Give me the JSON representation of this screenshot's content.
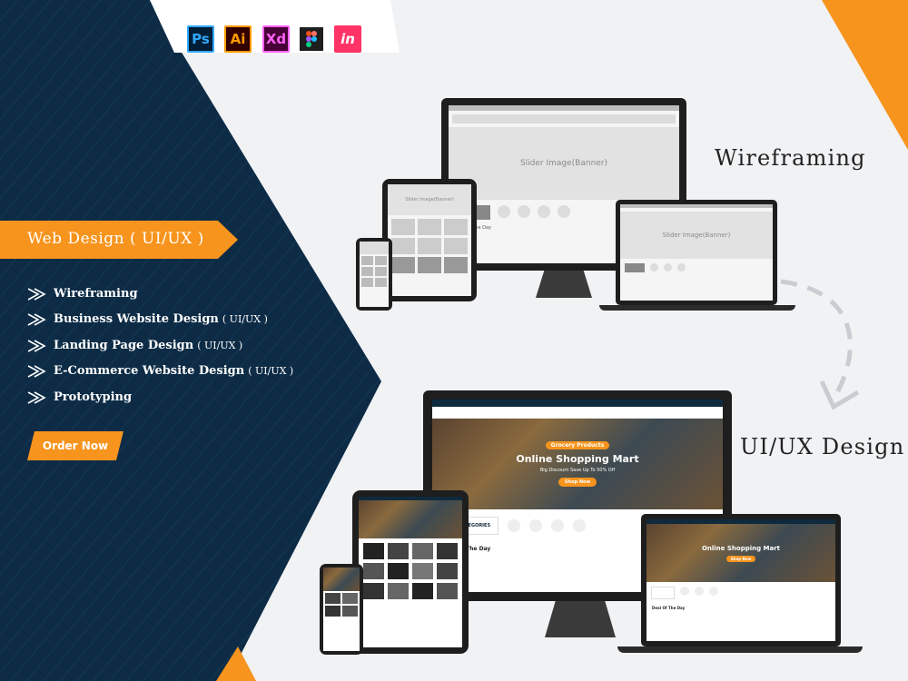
{
  "tools": [
    {
      "name": "Ps",
      "fg": "#31a8ff",
      "bg": "#001e36"
    },
    {
      "name": "Ai",
      "fg": "#ff9a00",
      "bg": "#330000"
    },
    {
      "name": "Xd",
      "fg": "#ff61f6",
      "bg": "#470137"
    },
    {
      "name": "figma",
      "fg": "#ffffff",
      "bg": "#1e1e1e"
    },
    {
      "name": "in",
      "fg": "#ffffff",
      "bg": "#ff3366"
    }
  ],
  "hero": {
    "title": "Web Design ( UI/UX )"
  },
  "services": [
    {
      "label": "Wireframing",
      "suffix": ""
    },
    {
      "label": "Business Website Design",
      "suffix": "( UI/UX )"
    },
    {
      "label": "Landing Page Design",
      "suffix": "( UI/UX )"
    },
    {
      "label": "E-Commerce Website Design",
      "suffix": "( UI/UX )"
    },
    {
      "label": "Prototyping",
      "suffix": ""
    }
  ],
  "cta": {
    "label": "Order Now"
  },
  "sections": {
    "wireframing": "Wireframing",
    "uiux": "UI/UX Design"
  },
  "wireframe": {
    "banner": "Slider Image(Banner)",
    "deal": "Deal Of The Day"
  },
  "mockup": {
    "hero_title": "Online Shopping Mart",
    "hero_tag": "Grocery Products",
    "hero_sub": "Big Discount Save Up To 50% Off",
    "hero_btn": "Shop Now",
    "categories": "ALL CATEGORIES",
    "deal": "Deal Of The Day"
  },
  "colors": {
    "navy": "#0d2b45",
    "orange": "#f7941d",
    "bg": "#f1f2f4"
  }
}
